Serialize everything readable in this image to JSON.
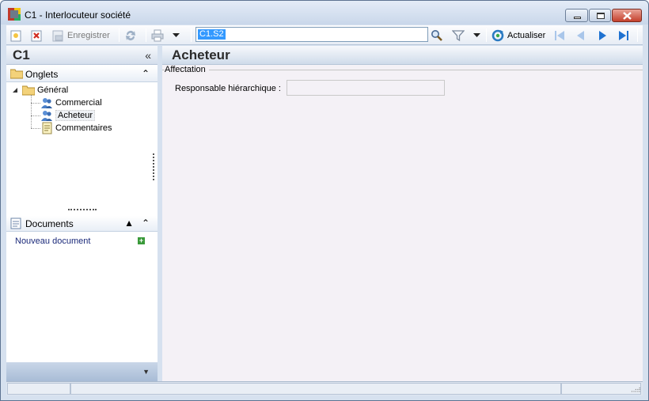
{
  "window": {
    "title": "C1 -  Interlocuteur société",
    "controls": [
      "minimize",
      "maximize",
      "close"
    ]
  },
  "toolbar": {
    "new_icon": "new-document-icon",
    "delete_icon": "delete-icon",
    "save_label": "Enregistrer",
    "search_value": "C1.S2",
    "refresh_label": "Actualiser"
  },
  "left_panel": {
    "title": "C1",
    "collapse_glyph": "«",
    "tabs_group": {
      "label": "Onglets",
      "tree": {
        "root": "Général",
        "children": [
          {
            "label": "Commercial",
            "icon": "contacts-icon"
          },
          {
            "label": "Acheteur",
            "icon": "contacts-icon",
            "selected": true
          },
          {
            "label": "Commentaires",
            "icon": "note-icon"
          }
        ]
      }
    },
    "documents_group": {
      "label": "Documents",
      "new_link": "Nouveau document"
    }
  },
  "main": {
    "title": "Acheteur",
    "section_label": "Affectation",
    "fields": [
      {
        "label": "Responsable hiérarchique :",
        "value": ""
      }
    ]
  },
  "colors": {
    "panel_bg": "#f4f1f6",
    "header_text": "#2b2b2b",
    "link": "#1b2a7a",
    "selection": "#3399ff"
  }
}
